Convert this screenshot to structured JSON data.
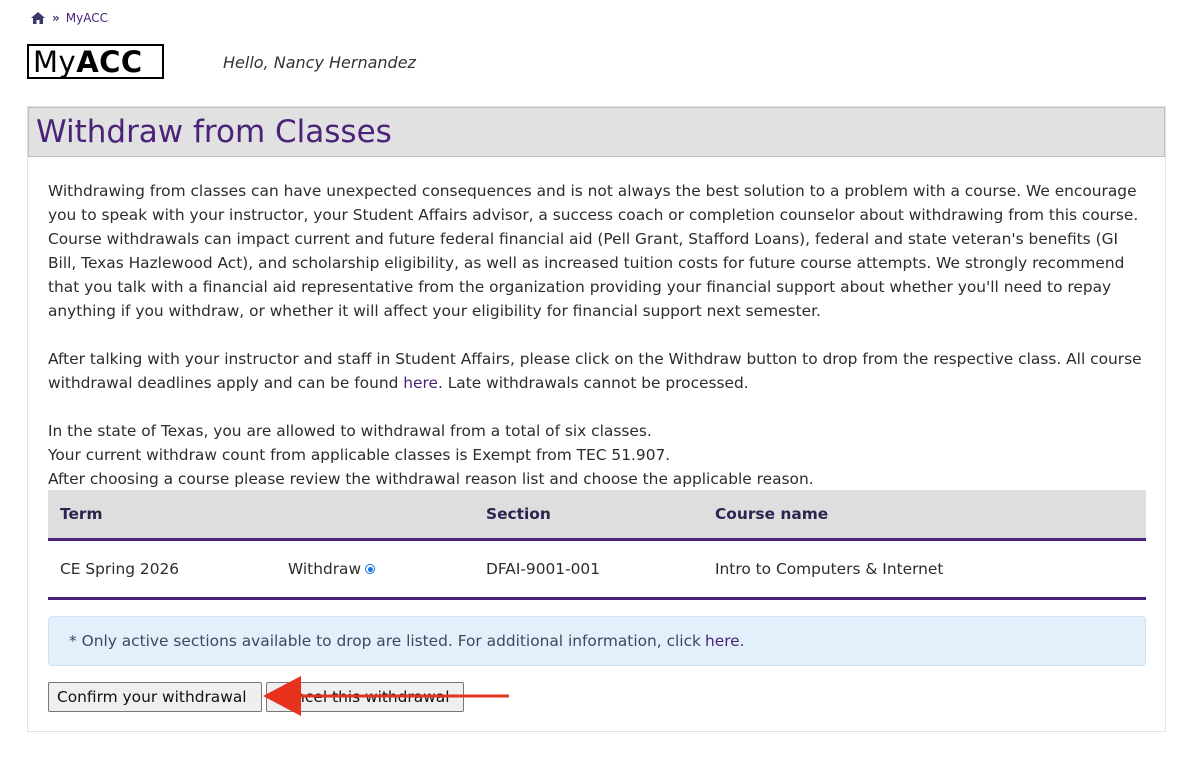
{
  "breadcrumb": {
    "current": "MyACC"
  },
  "logo": {
    "my": "My",
    "acc": "ACC"
  },
  "greeting": "Hello, Nancy Hernandez",
  "page_title": "Withdraw from Classes",
  "intro": {
    "p1": "Withdrawing from classes can have unexpected consequences and is not always the best solution to a problem with a course. We encourage you to speak with your instructor, your Student Affairs advisor, a success coach or completion counselor about withdrawing from this course. Course withdrawals can impact current and future federal financial aid (Pell Grant, Stafford Loans), federal and state veteran's benefits (GI Bill, Texas Hazlewood Act), and scholarship eligibility, as well as increased tuition costs for future course attempts. We strongly recommend that you talk with a financial aid representative from the organization providing your financial support about whether you'll need to repay anything if you withdraw, or whether it will affect your eligibility for financial support next semester.",
    "p2_before": "After talking with your instructor and staff in Student Affairs, please click on the Withdraw button to drop from the respective class. All course withdrawal deadlines apply and can be found ",
    "p2_link": "here",
    "p2_after": ". Late withdrawals cannot be processed.",
    "line1": "In the state of Texas, you are allowed to withdrawal from a total of six classes.",
    "line2": "Your current withdraw count from applicable classes is Exempt from TEC 51.907.",
    "line3": "After choosing a course please review the withdrawal reason list and choose the applicable reason."
  },
  "table": {
    "headers": {
      "term": "Term",
      "action": "",
      "section": "Section",
      "course": "Course name"
    },
    "rows": [
      {
        "term": "CE Spring 2026",
        "action": "Withdraw",
        "selected": true,
        "section": "DFAI-9001-001",
        "course": "Intro to Computers & Internet"
      }
    ]
  },
  "note": {
    "text": "* Only active sections available to drop are listed. For additional information, click",
    "link": "here",
    "after": "."
  },
  "buttons": {
    "confirm": "Confirm your withdrawal",
    "cancel": "Cancel this withdrawal"
  },
  "colors": {
    "accent": "#4a2278",
    "arrow": "#e8321e",
    "radio": "#1a73e8"
  }
}
